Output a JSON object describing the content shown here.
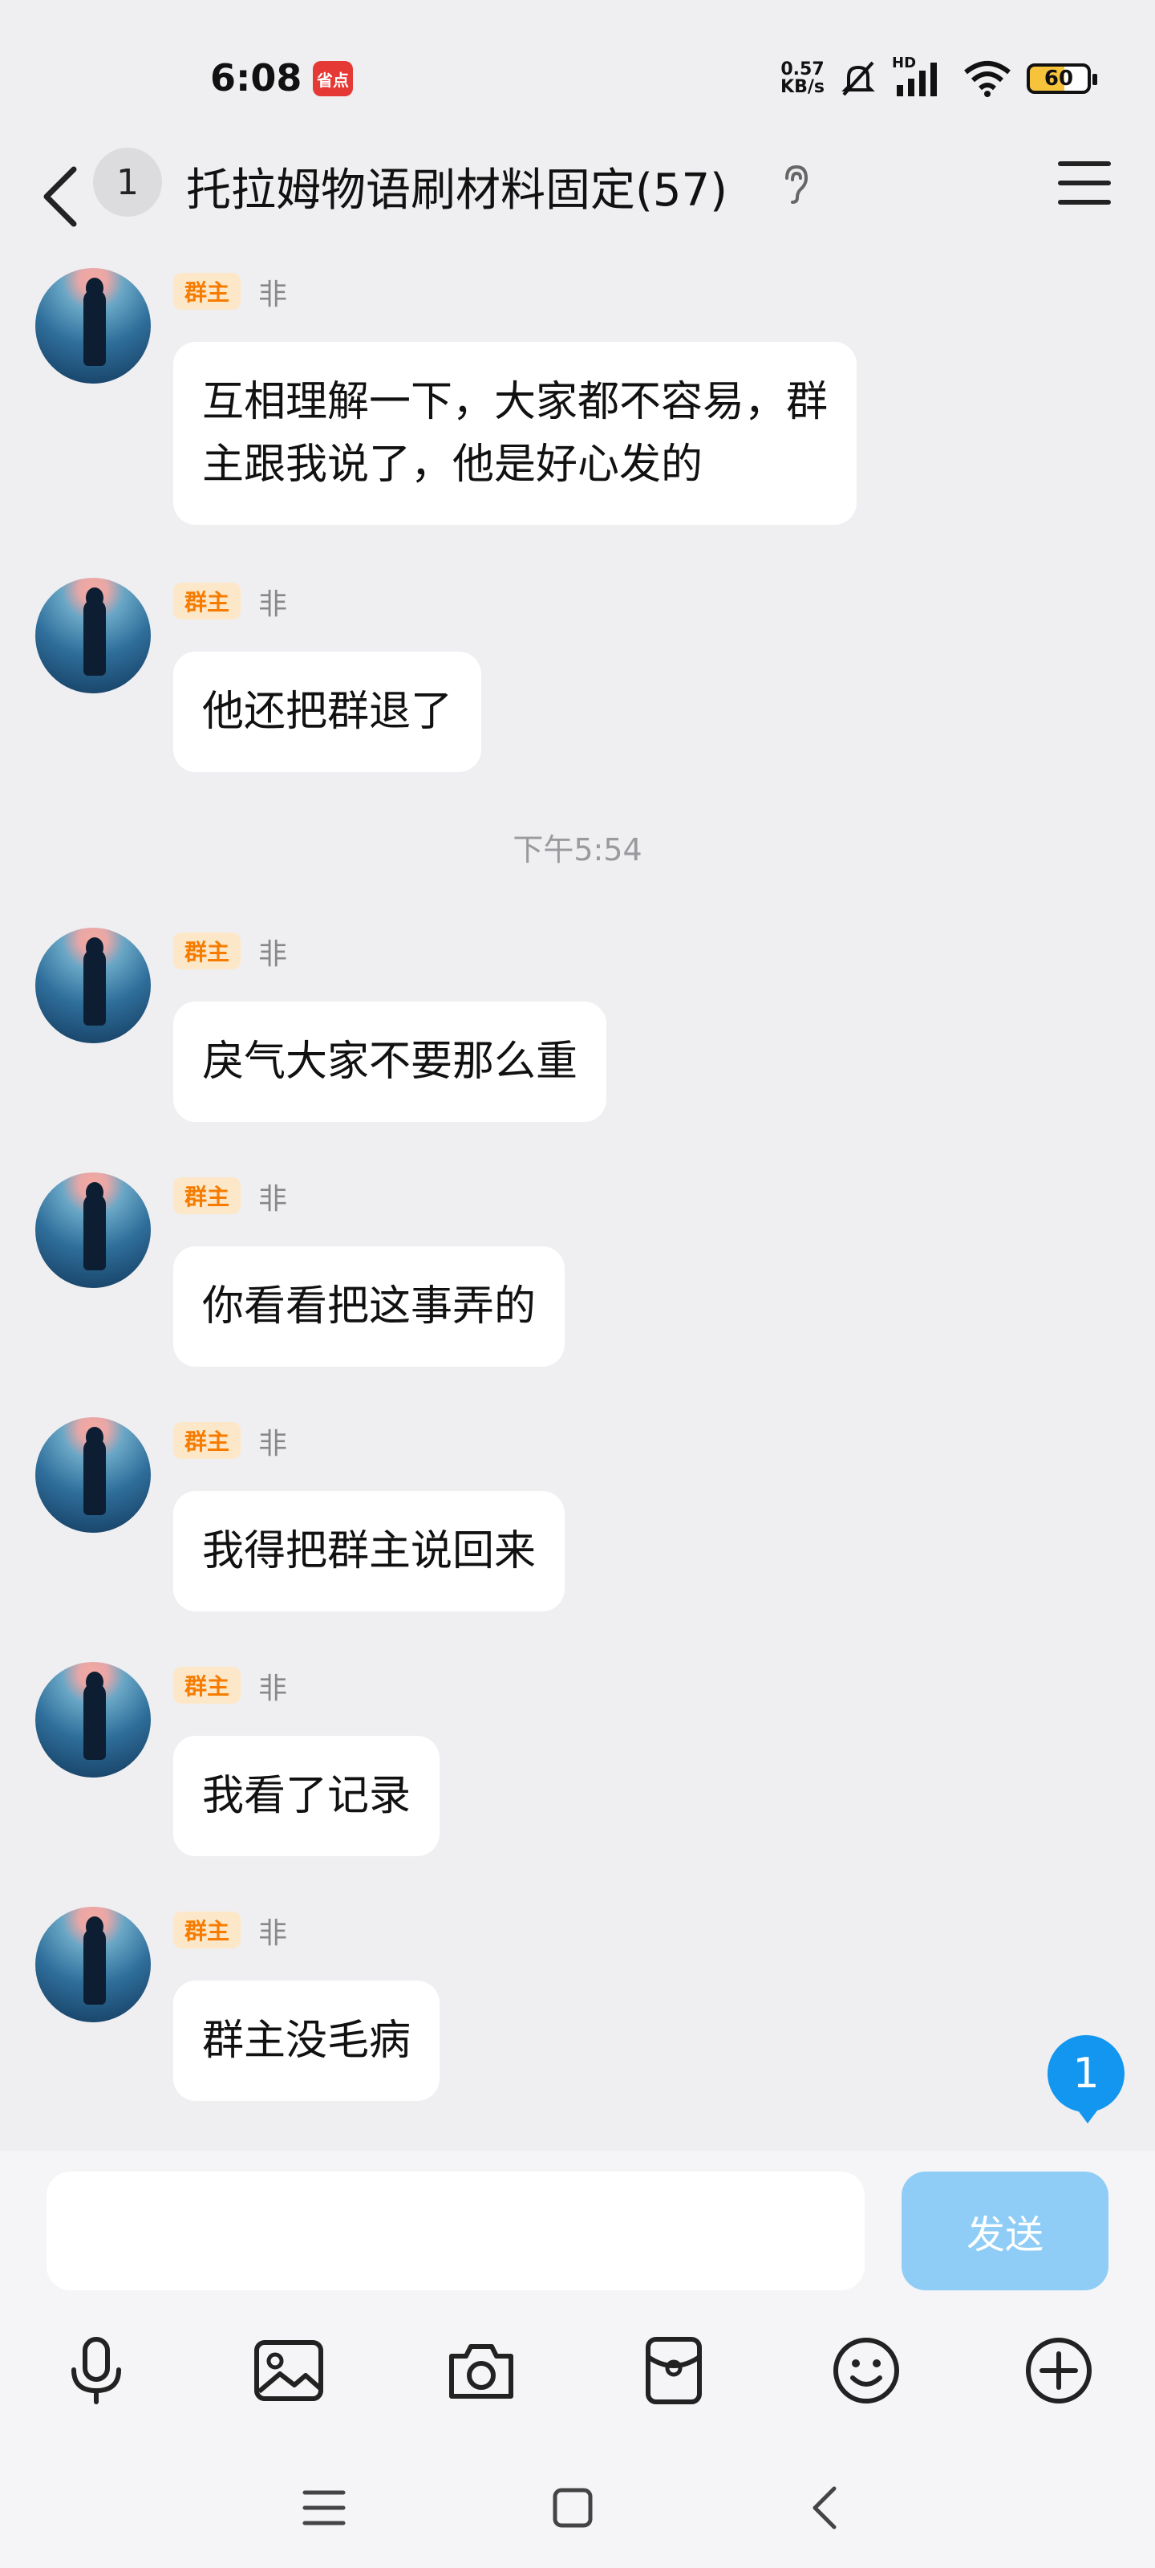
{
  "status_bar": {
    "time": "6:08",
    "app_icon_text": "省点",
    "net_speed_value": "0.57",
    "net_speed_unit": "KB/s",
    "signal_label": "HD",
    "battery": "60"
  },
  "header": {
    "unread_count": "1",
    "title": "托拉姆物语刷材料固定(57)"
  },
  "messages": [
    {
      "role": "群主",
      "sender": "非",
      "text_lines": [
        "互相理解一下，大家都不容易，群",
        "主跟我说了，他是好心发的"
      ]
    },
    {
      "role": "群主",
      "sender": "非",
      "text_lines": [
        "他还把群退了"
      ]
    },
    {
      "role": "群主",
      "sender": "非",
      "text_lines": [
        "戾气大家不要那么重"
      ]
    },
    {
      "role": "群主",
      "sender": "非",
      "text_lines": [
        "你看看把这事弄的"
      ]
    },
    {
      "role": "群主",
      "sender": "非",
      "text_lines": [
        "我得把群主说回来"
      ]
    },
    {
      "role": "群主",
      "sender": "非",
      "text_lines": [
        "我看了记录"
      ]
    },
    {
      "role": "群主",
      "sender": "非",
      "text_lines": [
        "群主没毛病"
      ]
    }
  ],
  "timestamp": "下午5:54",
  "new_message_badge": "1",
  "input": {
    "value": "",
    "send_label": "发送"
  },
  "toolbar_icons": [
    "microphone-icon",
    "image-icon",
    "camera-icon",
    "red-packet-icon",
    "emoji-icon",
    "plus-icon"
  ],
  "colors": {
    "background": "#efeff1",
    "accent": "#1296f0",
    "role_tag_bg": "#fde7c9",
    "role_tag_text": "#f57c00",
    "send_button": "#8fcdf6"
  }
}
